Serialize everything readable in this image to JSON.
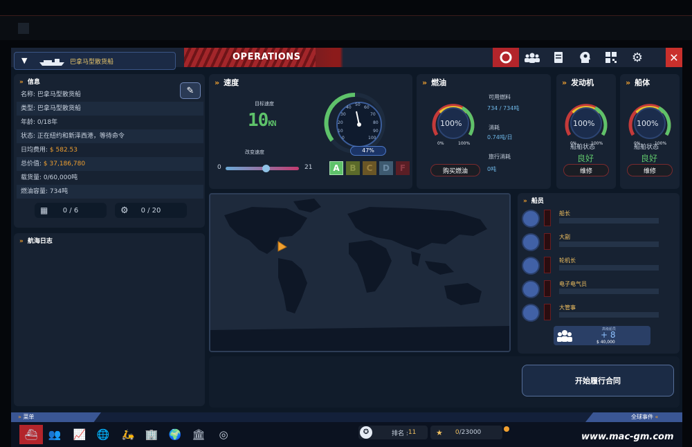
{
  "header": {
    "ship_selector": "巴拿马型散货船",
    "title": "OPERATIONS",
    "close": "✕"
  },
  "info": {
    "title": "信息",
    "rows": [
      {
        "k": "名称:",
        "v": "巴拿马型散货船"
      },
      {
        "k": "类型:",
        "v": "巴拿马型散货船"
      },
      {
        "k": "年龄:",
        "v": "0/18年"
      },
      {
        "k": "状态:",
        "v": "正在纽约和新泽西港，等待命令"
      },
      {
        "k": "日均费用:",
        "v": "$ 582.53"
      },
      {
        "k": "总价值:",
        "v": "$ 37,186,780"
      },
      {
        "k": "载货量:",
        "v": "0/60,000吨"
      },
      {
        "k": "燃油容量:",
        "v": "734吨"
      }
    ],
    "crew_count": "0 / 6",
    "upgrades": "0 / 20"
  },
  "log": {
    "title": "航海日志"
  },
  "speed": {
    "title": "速度",
    "target_label": "目标速度",
    "target_value": "10",
    "target_unit": "KN",
    "change_label": "改变速度",
    "slider_min": "0",
    "slider_max": "21",
    "slider_value": 0.55,
    "gauge_pct": "47%",
    "gauge_ticks": [
      "0",
      "10",
      "20",
      "30",
      "40",
      "50",
      "60",
      "70",
      "80",
      "90",
      "100"
    ],
    "grades": [
      "A",
      "B",
      "C",
      "D",
      "F"
    ]
  },
  "fuel": {
    "title": "燃油",
    "pct": "100%",
    "available_label": "可用燃料",
    "available_value": "734 / 734吨",
    "consume_label": "消耗",
    "consume_value": "0.74吨/日",
    "trip_label": "旅行消耗",
    "trip_value": "0吨",
    "buy": "购买燃油",
    "min": "0%",
    "max": "100%"
  },
  "engine": {
    "title": "发动机",
    "pct": "100%",
    "status_label": "船舶状态",
    "status": "良好",
    "repair": "维修",
    "min": "0%",
    "max": "100%"
  },
  "hull": {
    "title": "船体",
    "pct": "100%",
    "status_label": "船舶状态",
    "status": "良好",
    "repair": "维修",
    "min": "0%",
    "max": "100%"
  },
  "crew": {
    "title": "船员",
    "members": [
      "船长",
      "大副",
      "轮机长",
      "电子电气员",
      "大管事"
    ],
    "hire_label": "高级船员",
    "hire_plus": "+ 8",
    "hire_cost": "$ 40,000"
  },
  "actions": {
    "start_contract": "开始履行合同"
  },
  "bottom": {
    "menu": "菜单",
    "world_events": "全球事件",
    "rank_label": "排名 : ",
    "rank_value": "11",
    "stars_value": "0",
    "stars_total": "/23000"
  },
  "watermark": "www.mac-gm.com",
  "colors": {
    "accent": "#f0a030",
    "red": "#b3252b",
    "green": "#5ec26a",
    "blue": "#4161a6"
  }
}
